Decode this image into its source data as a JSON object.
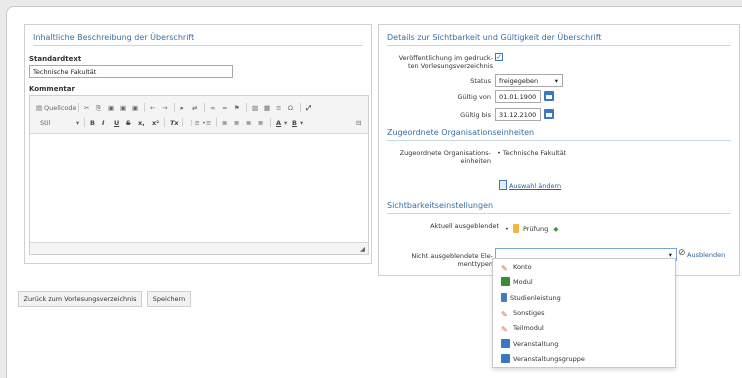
{
  "left_panel": {
    "title": "Inhaltliche Beschreibung der Überschrift",
    "standardtext_label": "Standardtext",
    "standardtext_value": "Technische Fakultät",
    "kommentar_label": "Kommentar",
    "toolbar": {
      "quellcode": "Quellcode",
      "stil": "Stil",
      "bold": "B",
      "italic": "I",
      "underline": "U",
      "strike": "S",
      "subscript": "x,",
      "superscript": "x²",
      "clear_format": "Tx",
      "text_color": "A",
      "background_color": "B"
    }
  },
  "right_panel": {
    "title": "Details zur Sichtbarkeit und Gültigkeit der Überschrift",
    "veroeffentlichung_label": "Veröffentlichung im gedruck-\nten Vorlesungsverzeichnis",
    "status_label": "Status",
    "status_value": "freigegeben",
    "gueltig_von_label": "Gültig von",
    "gueltig_von_value": "01.01.1900",
    "gueltig_bis_label": "Gültig bis",
    "gueltig_bis_value": "31.12.2100",
    "org_title": "Zugeordnete Organisationseinheiten",
    "org_label": "Zugeordnete Organisations-\neinheiten",
    "org_value": "Technische Fakultät",
    "auswahl_link": "Auswahl ändern",
    "sicht_title": "Sichtbarkeitseinstellungen",
    "aktuell_label": "Aktuell ausgeblendet",
    "aktuell_value": "Prüfung",
    "nicht_label": "Nicht ausgeblendete Ele-\nmenttypen",
    "ausblenden_label": "Ausblenden"
  },
  "buttons": {
    "back": "Zurück zum Vorlesungsverzeichnis",
    "save": "Speichern"
  },
  "dropdown_options": [
    {
      "label": "Konto",
      "icon": "pencil-icon",
      "color": "#e0603a"
    },
    {
      "label": "Modul",
      "icon": "puzzle-icon",
      "color": "#3a8a3a"
    },
    {
      "label": "Studienleistung",
      "icon": "student-icon",
      "color": "#4a7ab8"
    },
    {
      "label": "Sonstiges",
      "icon": "pencil-icon",
      "color": "#e0603a"
    },
    {
      "label": "Teilmodul",
      "icon": "pencil-icon",
      "color": "#e0603a"
    },
    {
      "label": "Veranstaltung",
      "icon": "event-icon",
      "color": "#3a78c4"
    },
    {
      "label": "Veranstaltungsgruppe",
      "icon": "event-group-icon",
      "color": "#3a78c4"
    }
  ],
  "colors": {
    "accent": "#3b6ea5",
    "link": "#2a5e9e",
    "calendar": "#3a78c4"
  }
}
